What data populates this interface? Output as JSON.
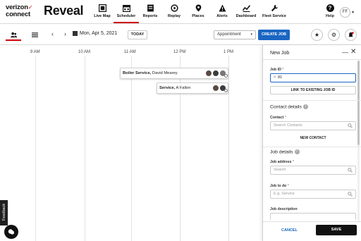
{
  "brand": {
    "logo_line1": "verizon",
    "logo_line2": "connect",
    "logo_check": "✓",
    "product": "Reveal"
  },
  "nav": {
    "items": [
      {
        "label": "Live Map",
        "icon": "live-map-icon",
        "active": false
      },
      {
        "label": "Scheduler",
        "icon": "scheduler-icon",
        "active": true
      },
      {
        "label": "Reports",
        "icon": "reports-icon",
        "active": false
      },
      {
        "label": "Replay",
        "icon": "replay-icon",
        "active": false
      },
      {
        "label": "Places",
        "icon": "places-icon",
        "active": false
      },
      {
        "label": "Alerts",
        "icon": "alerts-icon",
        "active": false
      },
      {
        "label": "Dashboard",
        "icon": "dashboard-icon",
        "active": false
      },
      {
        "label": "Fleet Service",
        "icon": "fleet-service-icon",
        "active": false
      }
    ],
    "help": {
      "label": "Help",
      "glyph": "?"
    },
    "user_initials": "FF",
    "user_caret": "▾"
  },
  "toolbar": {
    "prev_glyph": "‹",
    "next_glyph": "›",
    "date": "Mon, Apr 5, 2021",
    "today": "TODAY",
    "filter_value": "Appointment",
    "filter_caret": "▾",
    "create_job": "CREATE JOB",
    "star_glyph": "★",
    "gear_glyph": "⚙"
  },
  "timeline": {
    "hours": [
      "9 AM",
      "10 AM",
      "11 AM",
      "12 PM",
      "1 PM"
    ],
    "jobs": [
      {
        "service": "Boiler Service,",
        "customer": " David Mearey",
        "tech_count": 3
      },
      {
        "service": "Service,",
        "customer": " A Fallon",
        "tech_count": 2
      }
    ]
  },
  "feedback": {
    "label": "Feedback"
  },
  "panel": {
    "title": "New Job",
    "minimize_glyph": "—",
    "close_glyph": "✕",
    "job_id": {
      "label": "Job ID",
      "required": " *",
      "value": "81",
      "prefix": "#"
    },
    "link_button": "LINK TO EXISTING JOB ID",
    "contact_section": "Contact details",
    "contact": {
      "label": "Contact",
      "required": " *",
      "placeholder": "Search Contacts"
    },
    "new_contact": "NEW CONTACT",
    "job_section": "Job details",
    "address": {
      "label": "Job address",
      "required": " *",
      "placeholder": "Search"
    },
    "job_todo": {
      "label": "Job to do",
      "required": " *",
      "placeholder": "E.g. Service"
    },
    "description": {
      "label": "Job description"
    },
    "cancel": "CANCEL",
    "save": "SAVE"
  },
  "colors": {
    "accent_red": "#cd040b",
    "primary_blue": "#1a66c2",
    "save_black": "#111111"
  }
}
